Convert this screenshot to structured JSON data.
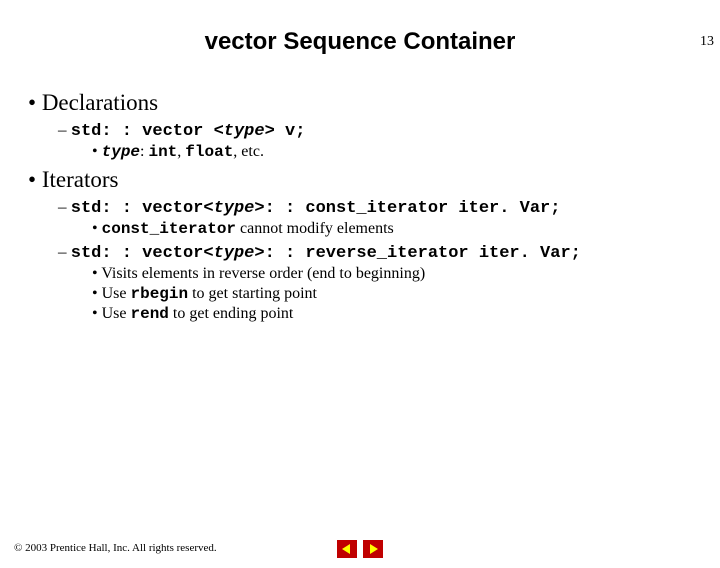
{
  "page_number": "13",
  "title": "vector Sequence Container",
  "bullets": {
    "decl_heading": "Declarations",
    "decl_code_pre": "std: : vector <",
    "decl_code_type": "type",
    "decl_code_post": "> v;",
    "decl_sub_pre": "type",
    "decl_sub_mid": ": ",
    "decl_sub_int": "int",
    "decl_sub_comma": ", ",
    "decl_sub_float": "float",
    "decl_sub_etc": ", etc.",
    "iter_heading": "Iterators",
    "iter1_pre": "std: : vector<",
    "iter1_type": "type",
    "iter1_post": ">: : const_iterator iter. Var;",
    "iter1_sub_mono": "const_iterator",
    "iter1_sub_text": " cannot modify elements",
    "iter2_pre": "std: : vector<",
    "iter2_type": "type",
    "iter2_post": ">: : reverse_iterator iter. Var;",
    "iter2_sub1": "Visits elements in reverse order (end to beginning)",
    "iter2_sub2_pre": "Use ",
    "iter2_sub2_mono": "rbegin",
    "iter2_sub2_post": " to get starting point",
    "iter2_sub3_pre": "Use ",
    "iter2_sub3_mono": "rend",
    "iter2_sub3_post": " to get ending point"
  },
  "footer": "© 2003 Prentice Hall, Inc. All rights reserved."
}
